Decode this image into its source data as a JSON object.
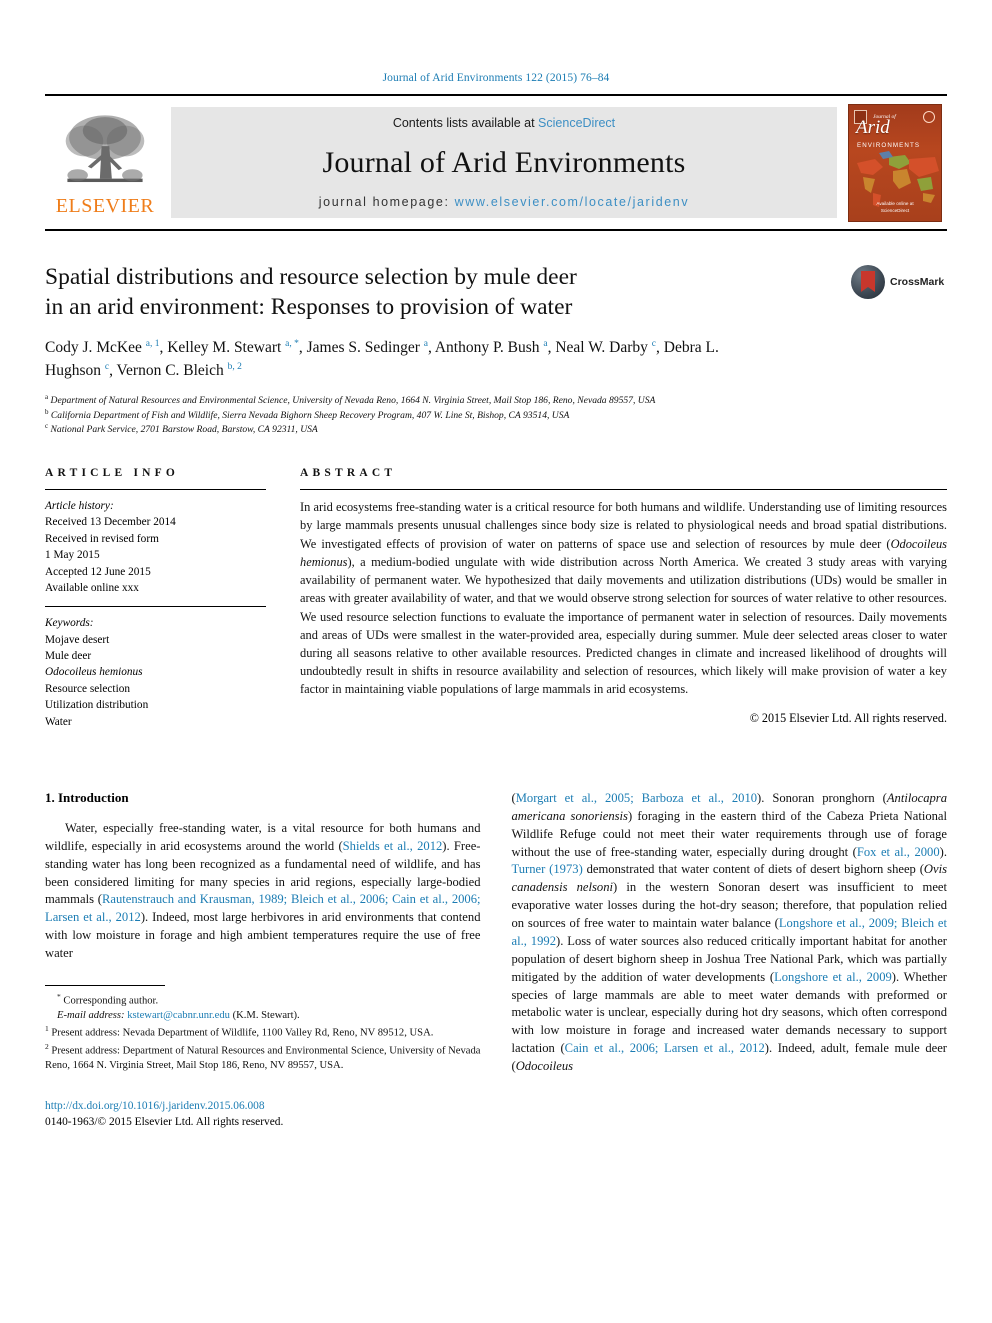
{
  "running_head": "Journal of Arid Environments 122 (2015) 76–84",
  "masthead": {
    "publisher_name": "ELSEVIER",
    "contents_prefix": "Contents lists available at ",
    "contents_link": "ScienceDirect",
    "journal_title": "Journal of Arid Environments",
    "homepage_prefix": "journal homepage: ",
    "homepage_url": "www.elsevier.com/locate/jaridenv",
    "cover": {
      "pre_title": "Journal of",
      "title": "Arid",
      "subtitle": "ENVIRONMENTS",
      "footer_line1": "Available online at",
      "footer_line2": "ScienceDirect"
    },
    "link_color": "#3d8fc4"
  },
  "article": {
    "title_line1": "Spatial distributions and resource selection by mule deer",
    "title_line2": "in an arid environment: Responses to provision of water",
    "crossmark_label": "CrossMark",
    "authors_html": "Cody J. McKee <sup>a, 1</sup>, Kelley M. Stewart <sup>a, *</sup>, James S. Sedinger <sup>a</sup>, Anthony P. Bush <sup>a</sup>, Neal W. Darby <sup>c</sup>, Debra L. Hughson <sup>c</sup>, Vernon C. Bleich <sup>b, 2</sup>",
    "affiliations": [
      {
        "marker": "a",
        "text": "Department of Natural Resources and Environmental Science, University of Nevada Reno, 1664 N. Virginia Street, Mail Stop 186, Reno, Nevada 89557, USA"
      },
      {
        "marker": "b",
        "text": "California Department of Fish and Wildlife, Sierra Nevada Bighorn Sheep Recovery Program, 407 W. Line St, Bishop, CA 93514, USA"
      },
      {
        "marker": "c",
        "text": "National Park Service, 2701 Barstow Road, Barstow, CA 92311, USA"
      }
    ]
  },
  "article_info": {
    "heading": "ARTICLE INFO",
    "history_label": "Article history:",
    "history": [
      "Received 13 December 2014",
      "Received in revised form",
      "1 May 2015",
      "Accepted 12 June 2015",
      "Available online xxx"
    ],
    "keywords_label": "Keywords:",
    "keywords": [
      {
        "text": "Mojave desert",
        "italic": false
      },
      {
        "text": "Mule deer",
        "italic": false
      },
      {
        "text": "Odocoileus hemionus",
        "italic": true
      },
      {
        "text": "Resource selection",
        "italic": false
      },
      {
        "text": "Utilization distribution",
        "italic": false
      },
      {
        "text": "Water",
        "italic": false
      }
    ]
  },
  "abstract": {
    "heading": "ABSTRACT",
    "body_html": "In arid ecosystems free-standing water is a critical resource for both humans and wildlife. Understanding use of limiting resources by large mammals presents unusual challenges since body size is related to physiological needs and broad spatial distributions. We investigated effects of provision of water on patterns of space use and selection of resources by mule deer (<i>Odocoileus hemionus</i>), a medium-bodied ungulate with wide distribution across North America. We created 3 study areas with varying availability of permanent water. We hypothesized that daily movements and utilization distributions (UDs) would be smaller in areas with greater availability of water, and that we would observe strong selection for sources of water relative to other resources. We used resource selection functions to evaluate the importance of permanent water in selection of resources. Daily movements and areas of UDs were smallest in the water-provided area, especially during summer. Mule deer selected areas closer to water during all seasons relative to other available resources. Predicted changes in climate and increased likelihood of droughts will undoubtedly result in shifts in resource availability and selection of resources, which likely will make provision of water a key factor in maintaining viable populations of large mammals in arid ecosystems.",
    "copyright": "© 2015 Elsevier Ltd. All rights reserved."
  },
  "introduction": {
    "heading": "1. Introduction",
    "left_paragraph_html": "Water, especially free-standing water, is a vital resource for both humans and wildlife, especially in arid ecosystems around the world (<span class=\"ref\">Shields et al., 2012</span>). Free-standing water has long been recognized as a fundamental need of wildlife, and has been considered limiting for many species in arid regions, especially large-bodied mammals (<span class=\"ref\">Rautenstrauch and Krausman, 1989; Bleich et al., 2006; Cain et al., 2006; Larsen et al., 2012</span>). Indeed, most large herbivores in arid environments that contend with low moisture in forage and high ambient temperatures require the use of free water",
    "right_paragraph_html": "(<span class=\"ref\">Morgart et al., 2005; Barboza et al., 2010</span>). Sonoran pronghorn (<i>Antilocapra americana sonoriensis</i>) foraging in the eastern third of the Cabeza Prieta National Wildlife Refuge could not meet their water requirements through use of forage without the use of free-standing water, especially during drought (<span class=\"ref\">Fox et al., 2000</span>). <span class=\"ref\">Turner (1973)</span> demonstrated that water content of diets of desert bighorn sheep (<i>Ovis canadensis nelsoni</i>) in the western Sonoran desert was insufficient to meet evaporative water losses during the hot-dry season; therefore, that population relied on sources of free water to maintain water balance (<span class=\"ref\">Longshore et al., 2009; Bleich et al., 1992</span>). Loss of water sources also reduced critically important habitat for another population of desert bighorn sheep in Joshua Tree National Park, which was partially mitigated by the addition of water developments (<span class=\"ref\">Longshore et al., 2009</span>). Whether species of large mammals are able to meet water demands with preformed or metabolic water is unclear, especially during hot dry seasons, which often correspond with low moisture in forage and increased water demands necessary to support lactation (<span class=\"ref\">Cain et al., 2006; Larsen et al., 2012</span>). Indeed, adult, female mule deer (<i>Odocoileus</i>"
  },
  "footnotes": {
    "corresponding_marker": "*",
    "corresponding_text": "Corresponding author.",
    "email_label": "E-mail address:",
    "email": "kstewart@cabnr.unr.edu",
    "email_attrib": "(K.M. Stewart).",
    "note1_marker": "1",
    "note1_text": "Present address: Nevada Department of Wildlife, 1100 Valley Rd, Reno, NV 89512, USA.",
    "note2_marker": "2",
    "note2_text": "Present address: Department of Natural Resources and Environmental Science, University of Nevada Reno, 1664 N. Virginia Street, Mail Stop 186, Reno, NV 89557, USA."
  },
  "footer": {
    "doi": "http://dx.doi.org/10.1016/j.jaridenv.2015.06.008",
    "issn_line": "0140-1963/© 2015 Elsevier Ltd. All rights reserved."
  },
  "colors": {
    "link_blue": "#1b7cb3",
    "light_blue": "#3d8fc4",
    "elsevier_orange": "#ef7d1a",
    "cover_red": "#a8401c",
    "crossmark_red": "#c8372c"
  }
}
